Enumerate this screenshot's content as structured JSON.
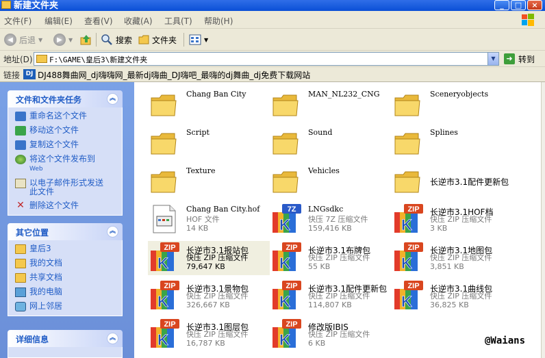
{
  "window": {
    "title": "新建文件夹",
    "controls": {
      "minimize": "_",
      "maximize": "□",
      "close": "×"
    }
  },
  "menu": [
    "文件(F)",
    "编辑(E)",
    "查看(V)",
    "收藏(A)",
    "工具(T)",
    "帮助(H)"
  ],
  "toolbar": {
    "back": "后退",
    "search": "搜索",
    "folders": "文件夹"
  },
  "address": {
    "label": "地址(D)",
    "value": "F:\\GAME\\皇后3\\新建文件夹",
    "go": "转到"
  },
  "links": {
    "label": "链接",
    "site_logo": "DJ",
    "site": "DJ488舞曲网_dj嗨嗨网_最新dj嗨曲_DJ嗨吧_最嗨的dj舞曲_dj免费下载网站"
  },
  "taskpane": {
    "file_tasks": {
      "title": "文件和文件夹任务",
      "items": [
        "重命名这个文件",
        "移动这个文件",
        "复制这个文件",
        "将这个文件发布到",
        "Web",
        "以电子邮件形式发送此文件",
        "删除这个文件"
      ]
    },
    "other_places": {
      "title": "其它位置",
      "items": [
        "皇后3",
        "我的文档",
        "共享文档",
        "我的电脑",
        "网上邻居"
      ]
    },
    "details": {
      "title": "详细信息"
    }
  },
  "files": [
    {
      "name": "Chang Ban City",
      "type": "folder"
    },
    {
      "name": "MAN_NL232_CNG",
      "type": "folder"
    },
    {
      "name": "Sceneryobjects",
      "type": "folder"
    },
    {
      "name": "Script",
      "type": "folder"
    },
    {
      "name": "Sound",
      "type": "folder"
    },
    {
      "name": "Splines",
      "type": "folder"
    },
    {
      "name": "Texture",
      "type": "folder"
    },
    {
      "name": "Vehicles",
      "type": "folder"
    },
    {
      "name": "长逆市3.1配件更新包",
      "type": "folder"
    },
    {
      "name": "Chang Ban City.hof",
      "type": "hof",
      "kind": "HOF 文件",
      "size": "14 KB"
    },
    {
      "name": "LNGsdkc",
      "type": "7z",
      "kind": "快压 7Z 压缩文件",
      "size": "159,416 KB"
    },
    {
      "name": "长逆市3.1HOF档",
      "type": "zip",
      "kind": "快压 ZIP 压缩文件",
      "size": "3 KB"
    },
    {
      "name": "长逆市3.1报站包",
      "type": "zip",
      "kind": "快压 ZIP 压缩文件",
      "size": "79,647 KB"
    },
    {
      "name": "长逆市3.1布牌包",
      "type": "zip",
      "kind": "快压 ZIP 压缩文件",
      "size": "55 KB"
    },
    {
      "name": "长逆市3.1地图包",
      "type": "zip",
      "kind": "快压 ZIP 压缩文件",
      "size": "3,851 KB"
    },
    {
      "name": "长逆市3.1景物包",
      "type": "zip",
      "kind": "快压 ZIP 压缩文件",
      "size": "326,667 KB"
    },
    {
      "name": "长逆市3.1配件更新包",
      "type": "zip",
      "kind": "快压 ZIP 压缩文件",
      "size": "114,807 KB"
    },
    {
      "name": "长逆市3.1曲线包",
      "type": "zip",
      "kind": "快压 ZIP 压缩文件",
      "size": "36,825 KB"
    },
    {
      "name": "长逆市3.1图层包",
      "type": "zip",
      "kind": "快压 ZIP 压缩文件",
      "size": "16,787 KB"
    },
    {
      "name": "修改版IBIS",
      "type": "zip",
      "kind": "快压 ZIP 压缩文件",
      "size": "6 KB"
    }
  ],
  "badges": {
    "zip": "ZIP",
    "7z": "7Z",
    "k": "K"
  },
  "watermark": "@Waians",
  "colors": {
    "title_bar": "#0a4fd6",
    "task_pane": "#6b8fd8",
    "link": "#215dc6"
  }
}
